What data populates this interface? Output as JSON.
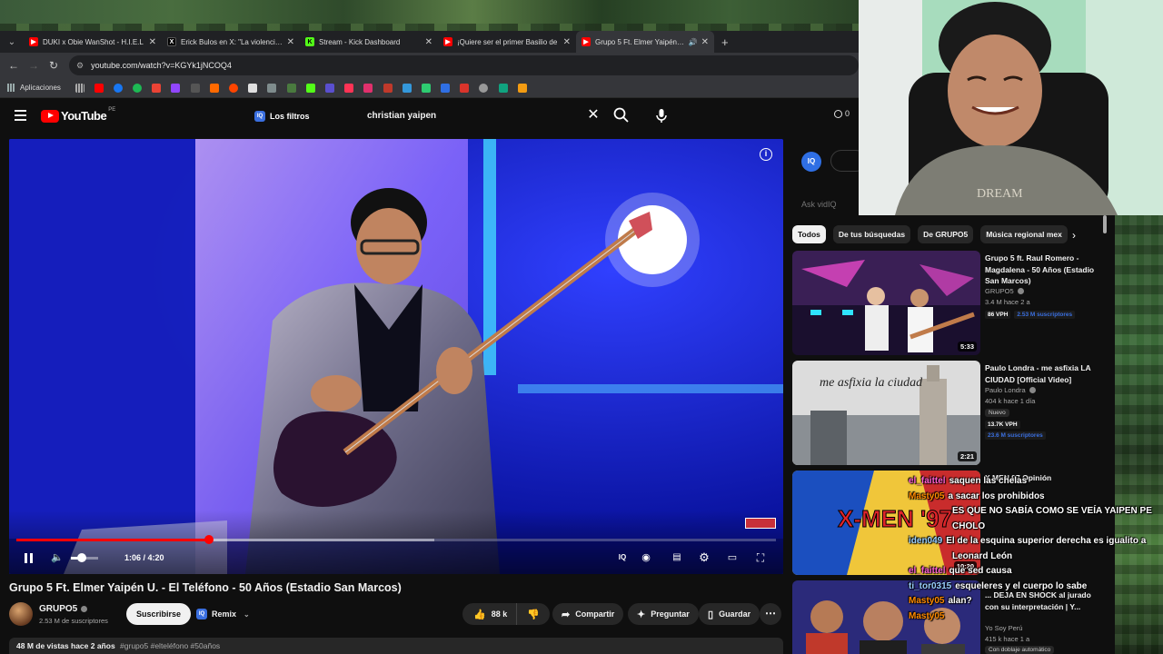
{
  "browser": {
    "tabs": [
      {
        "label": "DUKI x Obie WanShot - H.I.E.L",
        "fav_color": "#ff0000"
      },
      {
        "label": "Erick Bulos en X: \"La violencia c",
        "fav_color": "#000000"
      },
      {
        "label": "Stream - Kick Dashboard",
        "fav_color": "#53fc18"
      },
      {
        "label": "¡Quiere ser el primer Basilio de",
        "fav_color": "#ff0000"
      },
      {
        "label": "Grupo 5 Ft. Elmer Yaipén U.",
        "fav_color": "#ff0000"
      }
    ],
    "url": "youtube.com/watch?v=KGYk1jNCOQ4",
    "bookmarks_label": "Aplicaciones"
  },
  "header": {
    "logo_text": "YouTube",
    "country_code": "PE",
    "filters_label": "Los filtros",
    "search_value": "christian yaipen",
    "counter": "0"
  },
  "player": {
    "time": "1:06 / 4:20",
    "progress_fraction": 0.254,
    "buffer_fraction": 0.55,
    "volume_fraction": 0.4
  },
  "video": {
    "title": "Grupo 5 Ft. Elmer Yaipén U. - El Teléfono - 50 Años (Estadio San Marcos)",
    "channel": "GRUPO5",
    "subscribers": "2.53 M de suscriptores",
    "subscribe_label": "Suscribirse",
    "remix_label": "Remix",
    "likes": "88 k",
    "share_label": "Compartir",
    "ask_label": "Preguntar",
    "save_label": "Guardar",
    "views_date": "48 M de vistas  hace 2 años",
    "hashtags": "#grupo5 #elteléfono #50años"
  },
  "sidebar": {
    "ask_placeholder": "Ask vidIQ",
    "chips": [
      "Todos",
      "De tus búsquedas",
      "De GRUPO5",
      "Música regional mex"
    ],
    "recs": [
      {
        "title": "Grupo 5 ft. Raul Romero - Magdalena - 50 Años (Estadio San Marcos)",
        "channel": "GRUPO5",
        "meta": "3.4 M  hace 2 a",
        "vph": "86 VPH",
        "vph2": "2.53 M suscriptores",
        "duration": "5:33"
      },
      {
        "title": "Paulo Londra - me asfixia LA CIUDAD [Official Video]",
        "channel": "Paulo Londra",
        "meta": "404 k  hace 1 día",
        "badge": "Nuevo",
        "vph": "13.7K VPH",
        "vph2": "23.6 M suscriptores",
        "duration": "2:21"
      },
      {
        "title": "X MEN 97 Opinión",
        "channel": "",
        "meta": "",
        "duration": "10:20",
        "thumb_text": "X-MEN '97"
      },
      {
        "title": "... DEJA EN SHOCK al jurado con su interpretación | Y...",
        "channel": "Yo Soy Perú",
        "meta": "415 k  hace 1 a",
        "badge": "Con doblaje automático"
      }
    ]
  },
  "chat": [
    {
      "user": "el_faittel",
      "msg": "saquen las chelas",
      "color": "#ff5fd2"
    },
    {
      "user": "Masty05",
      "msg": "a sacar los prohibidos",
      "color": "#ff8a00"
    },
    {
      "user": "",
      "msg": "ES QUE NO SABÍA COMO SE VEÍA YAIPEN PE",
      "color": "#ffffff"
    },
    {
      "user": "",
      "msg": "CHOLO",
      "color": "#ffffff"
    },
    {
      "user": "iden049",
      "msg": "El de la esquina superior derecha es igualito a",
      "color": "#9ad0ff"
    },
    {
      "user": "",
      "msg": "Leonard León",
      "color": "#ffffff"
    },
    {
      "user": "el_faittel",
      "msg": "que sed causa",
      "color": "#ff5fd2"
    },
    {
      "user": "ti_tor0315",
      "msg": "esqueleres y el cuerpo lo sabe",
      "color": "#9ad0ff"
    },
    {
      "user": "Masty05",
      "msg": "alan?",
      "color": "#ff8a00"
    },
    {
      "user": "Masty05",
      "msg": "",
      "color": "#ff8a00"
    }
  ],
  "colors": {
    "accent": "#ff0000",
    "vidiq": "#2f6fe4"
  }
}
